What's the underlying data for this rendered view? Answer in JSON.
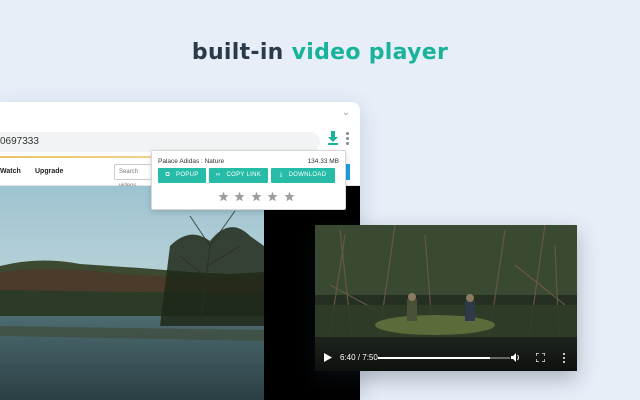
{
  "headline": {
    "part1": "built-in",
    "part2": "video player"
  },
  "browser": {
    "address": "0697333",
    "nav": {
      "watch": "Watch",
      "upgrade": "Upgrade",
      "search_placeholder": "Search videos"
    }
  },
  "popup": {
    "title": "Palace Adidas : Nature",
    "size": "134.33 MB",
    "buttons": {
      "popup": "POPUP",
      "copy_link": "COPY LINK",
      "download": "DOWNLOAD"
    },
    "rating_stars": 5
  },
  "player": {
    "time": "6:40 / 7:50",
    "progress": 0.85
  },
  "colors": {
    "accent": "#18b39a",
    "button": "#27bca7",
    "background": "#e7eef8",
    "headline_dark": "#2b3a4a"
  },
  "icons": [
    "chevron-down-icon",
    "download-arrow-icon",
    "kebab-menu-icon",
    "popup-icon",
    "link-icon",
    "download-icon",
    "star-icon",
    "play-icon",
    "volume-icon",
    "fullscreen-icon",
    "more-icon"
  ]
}
